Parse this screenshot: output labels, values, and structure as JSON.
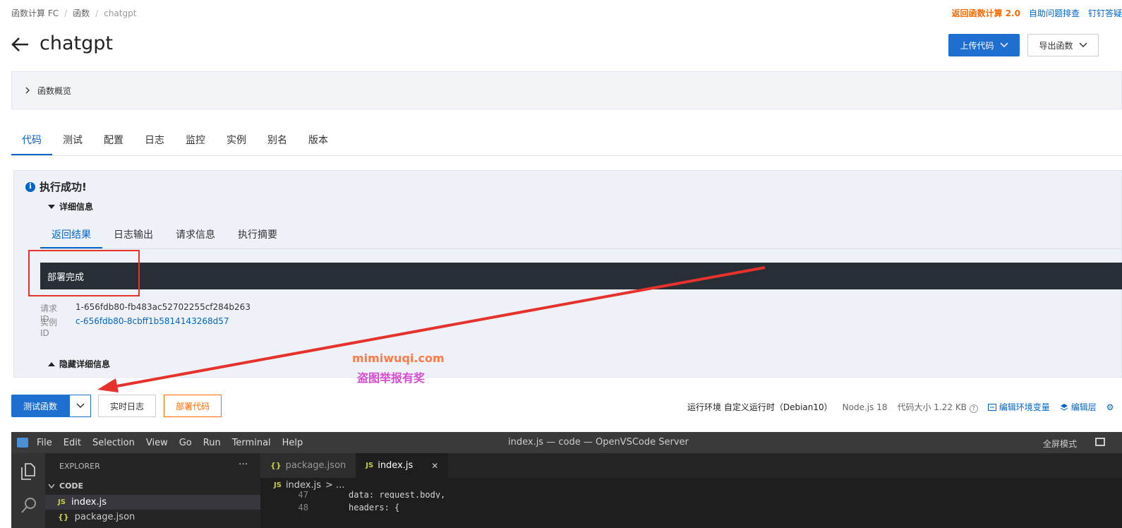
{
  "breadcrumb": [
    "函数计算 FC",
    "函数",
    "chatgpt"
  ],
  "top_links": {
    "back_v2": "返回函数计算 2.0",
    "self_check": "自助问题排查",
    "dingtalk": "钉钉答疑"
  },
  "page": {
    "title": "chatgpt",
    "upload_btn": "上传代码",
    "export_btn": "导出函数"
  },
  "overview": {
    "label": "函数概览"
  },
  "tabs": [
    "代码",
    "测试",
    "配置",
    "日志",
    "监控",
    "实例",
    "别名",
    "版本"
  ],
  "result": {
    "status": "执行成功!",
    "details_toggle": "详细信息",
    "subtabs": [
      "返回结果",
      "日志输出",
      "请求信息",
      "执行摘要"
    ],
    "output": "部署完成",
    "request_id_label": "请求 ID",
    "request_id": "1-656fdb80-fb483ac52702255cf284b263",
    "instance_id_label": "实例 ID",
    "instance_id": "c-656fdb80-8cbff1b5814143268d57",
    "hide_toggle": "隐藏详细信息"
  },
  "watermark": {
    "line1": "mimiwuqi.com",
    "line2": "盗图举报有奖"
  },
  "actions": {
    "test": "测试函数",
    "realtime_log": "实时日志",
    "deploy": "部署代码"
  },
  "env": {
    "runtime_label": "运行环境",
    "runtime": "自定义运行时（Debian10）",
    "node": "Node.js 18",
    "code_size": "代码大小 1.22 KB",
    "edit_env": "编辑环境变量",
    "edit_layer": "编辑层"
  },
  "vscode": {
    "menu": [
      "File",
      "Edit",
      "Selection",
      "View",
      "Go",
      "Run",
      "Terminal",
      "Help"
    ],
    "window_title": "index.js — code — OpenVSCode Server",
    "fullscreen": "全屏模式",
    "explorer_title": "EXPLORER",
    "explorer_more": "···",
    "folder": "CODE",
    "files": [
      "index.js",
      "package.json"
    ],
    "tabs": [
      {
        "icon": "{}",
        "name": "package.json"
      },
      {
        "icon": "JS",
        "name": "index.js"
      }
    ],
    "tab_close": "✕",
    "breadcrumb_file": "index.js",
    "breadcrumb_rest": "> ...",
    "lines": [
      {
        "n": "47",
        "code": "data: request.body,"
      },
      {
        "n": "48",
        "code": "headers: {"
      }
    ]
  },
  "colors": {
    "primary": "#1f6fd1",
    "accent_orange": "#ff6a00",
    "annotation_red": "#e5322d"
  }
}
